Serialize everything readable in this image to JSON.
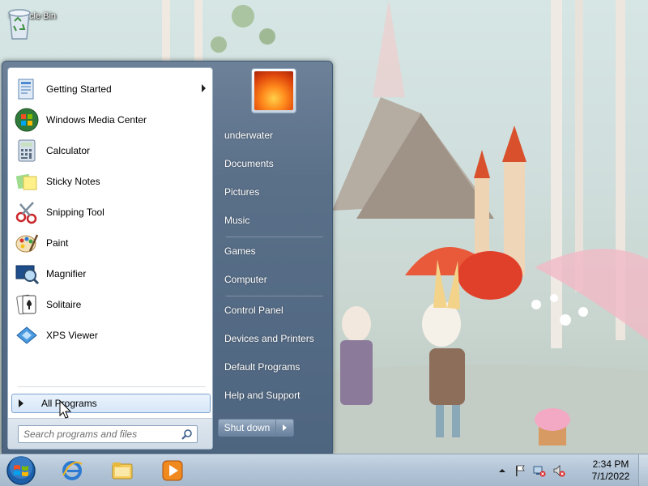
{
  "desktop": {
    "recycle_bin_label": "Recycle Bin"
  },
  "start_menu": {
    "pinned_programs": [
      {
        "label": "Getting Started",
        "icon": "getting-started-icon",
        "has_submenu": true
      },
      {
        "label": "Windows Media Center",
        "icon": "media-center-icon",
        "has_submenu": false
      },
      {
        "label": "Calculator",
        "icon": "calculator-icon",
        "has_submenu": false
      },
      {
        "label": "Sticky Notes",
        "icon": "sticky-notes-icon",
        "has_submenu": false
      },
      {
        "label": "Snipping Tool",
        "icon": "snipping-tool-icon",
        "has_submenu": false
      },
      {
        "label": "Paint",
        "icon": "paint-icon",
        "has_submenu": false
      },
      {
        "label": "Magnifier",
        "icon": "magnifier-icon",
        "has_submenu": false
      },
      {
        "label": "Solitaire",
        "icon": "solitaire-icon",
        "has_submenu": false
      },
      {
        "label": "XPS Viewer",
        "icon": "xps-viewer-icon",
        "has_submenu": false
      }
    ],
    "all_programs_label": "All Programs",
    "search_placeholder": "Search programs and files",
    "right_items": [
      {
        "label": "underwater"
      },
      {
        "label": "Documents"
      },
      {
        "label": "Pictures"
      },
      {
        "label": "Music"
      },
      {
        "label": "Games"
      },
      {
        "label": "Computer"
      },
      {
        "label": "Control Panel"
      },
      {
        "label": "Devices and Printers"
      },
      {
        "label": "Default Programs"
      },
      {
        "label": "Help and Support"
      }
    ],
    "shutdown_label": "Shut down"
  },
  "taskbar": {
    "pinned": [
      "internet-explorer-icon",
      "windows-explorer-icon",
      "media-player-icon"
    ],
    "clock_time": "2:34 PM",
    "clock_date": "7/1/2022",
    "accent": "#4f89c8"
  }
}
